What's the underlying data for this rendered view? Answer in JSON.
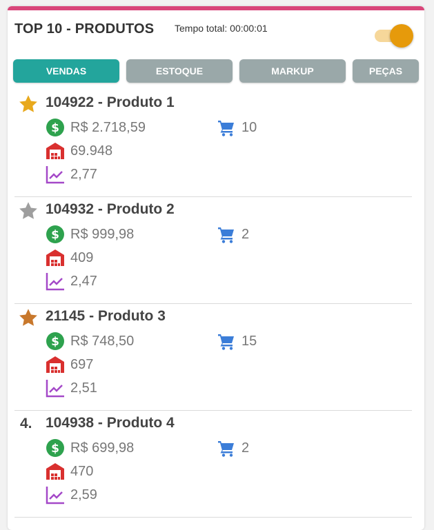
{
  "header": {
    "title": "TOP 10 - PRODUTOS",
    "time_label": "Tempo total: 00:00:01",
    "toggle_on": true
  },
  "tabs": [
    {
      "label": "VENDAS",
      "active": true
    },
    {
      "label": "ESTOQUE",
      "active": false
    },
    {
      "label": "MARKUP",
      "active": false
    },
    {
      "label": "PEÇAS",
      "active": false
    }
  ],
  "colors": {
    "accent_bar": "#d9467a",
    "tab_active": "#23a59c",
    "tab_inactive": "#9aa8a9",
    "gold": "#e8a91d",
    "silver": "#9e9e9e",
    "bronze": "#c8782c",
    "money_green": "#2ea24e",
    "cart_blue": "#3b7dd8",
    "stock_red": "#d9302f",
    "markup_purple": "#a448c8"
  },
  "products": [
    {
      "rank_icon": "gold-star-icon",
      "rank_text": "",
      "name": "104922 - Produto 1",
      "value": "R$ 2.718,59",
      "quantity": "10",
      "stock": "69.948",
      "markup": "2,77"
    },
    {
      "rank_icon": "silver-star-icon",
      "rank_text": "",
      "name": "104932 - Produto 2",
      "value": "R$ 999,98",
      "quantity": "2",
      "stock": "409",
      "markup": "2,47"
    },
    {
      "rank_icon": "bronze-star-icon",
      "rank_text": "",
      "name": "21145 - Produto 3",
      "value": "R$ 748,50",
      "quantity": "15",
      "stock": "697",
      "markup": "2,51"
    },
    {
      "rank_icon": "",
      "rank_text": "4.",
      "name": "104938 - Produto 4",
      "value": "R$ 699,98",
      "quantity": "2",
      "stock": "470",
      "markup": "2,59"
    }
  ]
}
